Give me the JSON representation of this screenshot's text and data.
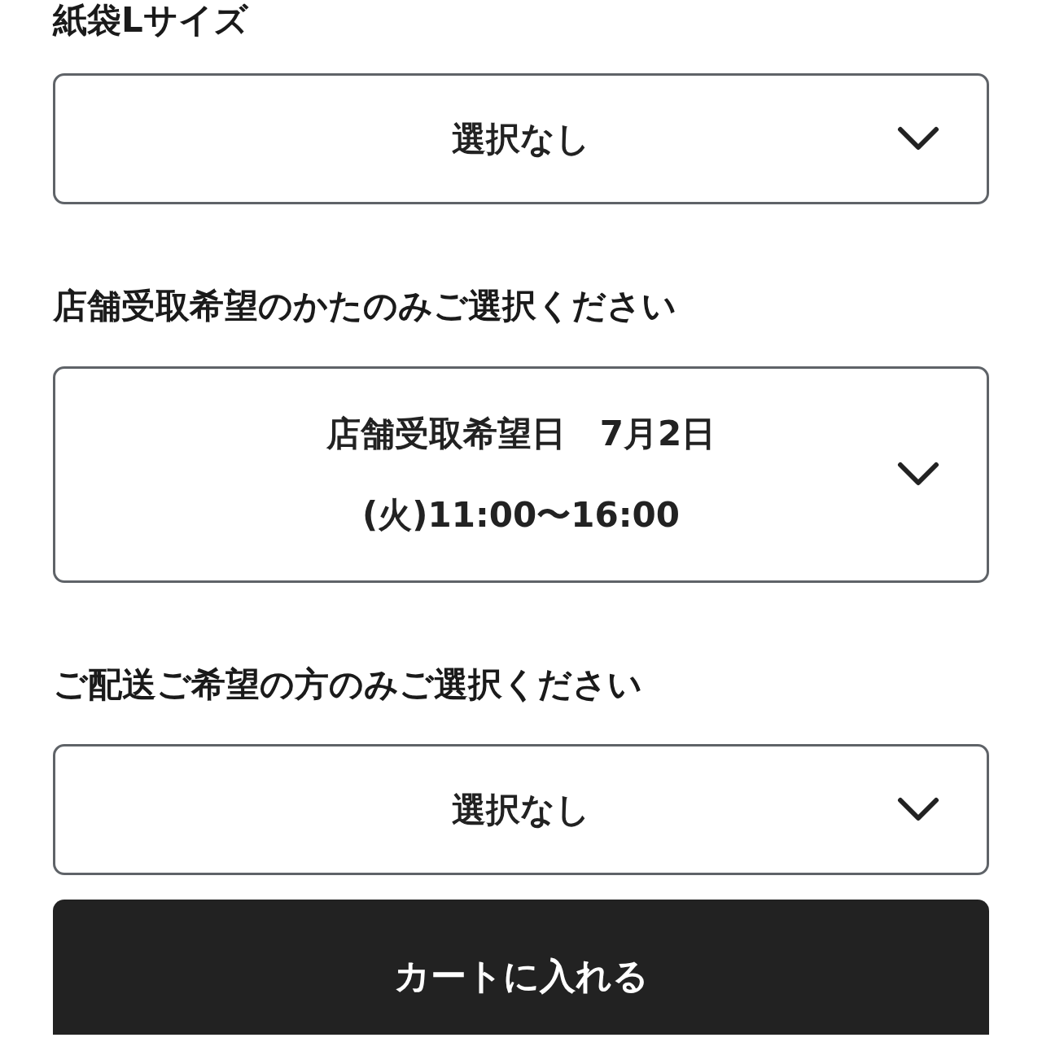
{
  "sections": [
    {
      "label": "紙袋Lサイズ",
      "select": {
        "lines": [
          "選択なし"
        ]
      }
    },
    {
      "label": "店舗受取希望のかたのみご選択ください",
      "select": {
        "lines": [
          "店舗受取希望日　7月2日",
          "(火)11:00〜16:00"
        ]
      }
    },
    {
      "label": "ご配送ご希望の方のみご選択ください",
      "select": {
        "lines": [
          "選択なし"
        ]
      }
    }
  ],
  "button": {
    "label": "カートに入れる"
  }
}
